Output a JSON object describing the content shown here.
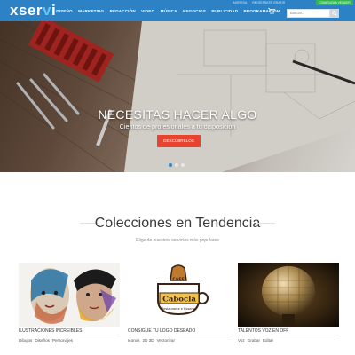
{
  "header": {
    "brand": {
      "main": "xser",
      "accent": "v",
      "end": "i"
    },
    "nav": [
      {
        "id": "diseno",
        "label": "DISEÑO"
      },
      {
        "id": "marketing",
        "label": "MARKETING"
      },
      {
        "id": "redaccion",
        "label": "REDACCIÓN"
      },
      {
        "id": "video",
        "label": "VIDEO"
      },
      {
        "id": "musica",
        "label": "MÚSICA"
      },
      {
        "id": "negocios",
        "label": "NEGOCIOS"
      },
      {
        "id": "publicidad",
        "label": "PUBLICIDAD"
      },
      {
        "id": "programacion",
        "label": "PROGRAMACIÓN"
      }
    ],
    "util_links": [
      "INGRESA",
      "REGÍSTRATE GRATIS"
    ],
    "util_button": "COMIENZA A VENDER",
    "search_placeholder": "Buscar..."
  },
  "hero": {
    "title": "NECESITAS HACER ALGO",
    "subtitle": "Cientos de profesionales a tu disposición",
    "button": "DESCÚBRELOS"
  },
  "section": {
    "title": "Colecciones en Tendencia",
    "subtitle": "Elige de nuestros servicios más populares"
  },
  "cards": [
    {
      "id": "ilustraciones",
      "title": "ILUSTRACIONES INCREIBLES",
      "tags": [
        "Dibujos",
        "Diseños",
        "Personajes"
      ]
    },
    {
      "id": "logo",
      "title": "CONSIGUE TU LOGO DESEADO",
      "tags": [
        "Iconos",
        "2D 3D",
        "Vectorizar"
      ],
      "logo_text": {
        "top": "CAFE",
        "main": "Cabocla",
        "bottom": "Restaurante e Pizzaria"
      }
    },
    {
      "id": "voz",
      "title": "TALENTOS VOZ EN OFF",
      "tags": [
        "Voz",
        "Grabar",
        "Editar"
      ]
    }
  ],
  "colors": {
    "nav_bg": "#2c82c4",
    "cta_red": "#e8432f",
    "cta_green": "#35b550",
    "active_dot": "#2f86c8"
  },
  "icons": [
    "cart-icon",
    "search-icon"
  ]
}
